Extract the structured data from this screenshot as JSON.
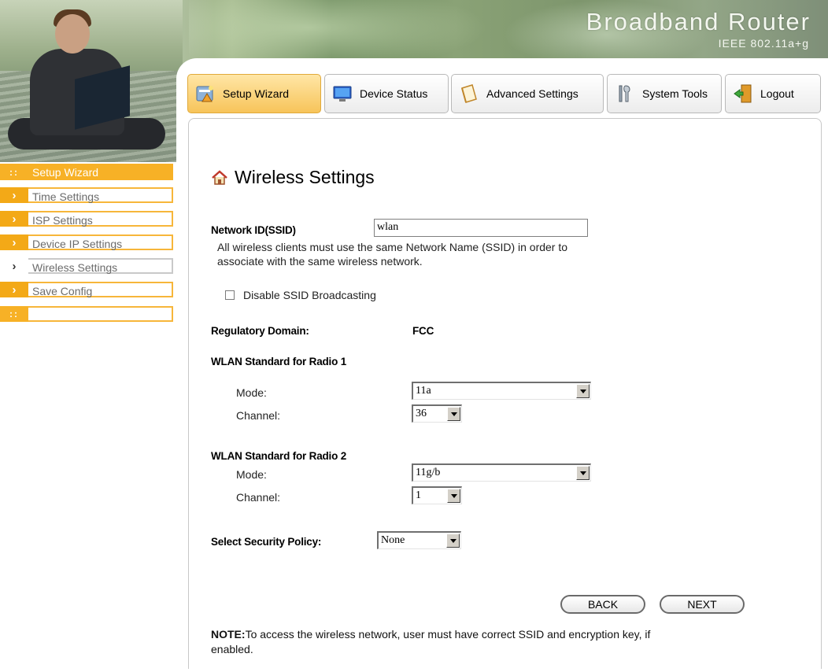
{
  "banner": {
    "title": "Broadband Router",
    "subtitle": "IEEE 802.11a+g"
  },
  "tabs": [
    {
      "label": "Setup Wizard",
      "icon": "setup-wizard-icon",
      "active": true
    },
    {
      "label": "Device Status",
      "icon": "monitor-icon",
      "active": false
    },
    {
      "label": "Advanced Settings",
      "icon": "notebook-icon",
      "active": false
    },
    {
      "label": "System Tools",
      "icon": "tools-icon",
      "active": false
    },
    {
      "label": "Logout",
      "icon": "door-exit-icon",
      "active": false
    }
  ],
  "sidebar": {
    "header": "Setup Wizard",
    "items": [
      {
        "label": "Time Settings",
        "current": false
      },
      {
        "label": "ISP Settings",
        "current": false
      },
      {
        "label": "Device IP Settings",
        "current": false
      },
      {
        "label": "Wireless Settings",
        "current": true
      },
      {
        "label": "Save Config",
        "current": false
      }
    ]
  },
  "page": {
    "title": "Wireless Settings",
    "ssid_label": "Network ID(SSID)",
    "ssid_value": "wlan",
    "ssid_help_1": "All wireless clients must use the same Network Name (SSID) in order to",
    "ssid_help_2": "associate with the same wireless network.",
    "disable_broadcast_label": "Disable SSID Broadcasting",
    "disable_broadcast_checked": false,
    "regdomain_label": "Regulatory Domain:",
    "regdomain_value": "FCC",
    "radio1_heading": "WLAN Standard for Radio 1",
    "radio1_mode_label": "Mode:",
    "radio1_mode_value": "11a",
    "radio1_channel_label": "Channel:",
    "radio1_channel_value": "36",
    "radio2_heading": "WLAN Standard for Radio 2",
    "radio2_mode_label": "Mode:",
    "radio2_mode_value": "11g/b",
    "radio2_channel_label": "Channel:",
    "radio2_channel_value": "1",
    "security_label": "Select Security Policy:",
    "security_value": "None",
    "back_label": "BACK",
    "next_label": "NEXT",
    "note_bold": "NOTE:",
    "note_text_1": "To access the wireless network, user must have correct SSID and encryption key, if",
    "note_text_2": "enabled."
  },
  "colors": {
    "accent_orange": "#f7b126",
    "active_tab": "#f7c45a"
  }
}
